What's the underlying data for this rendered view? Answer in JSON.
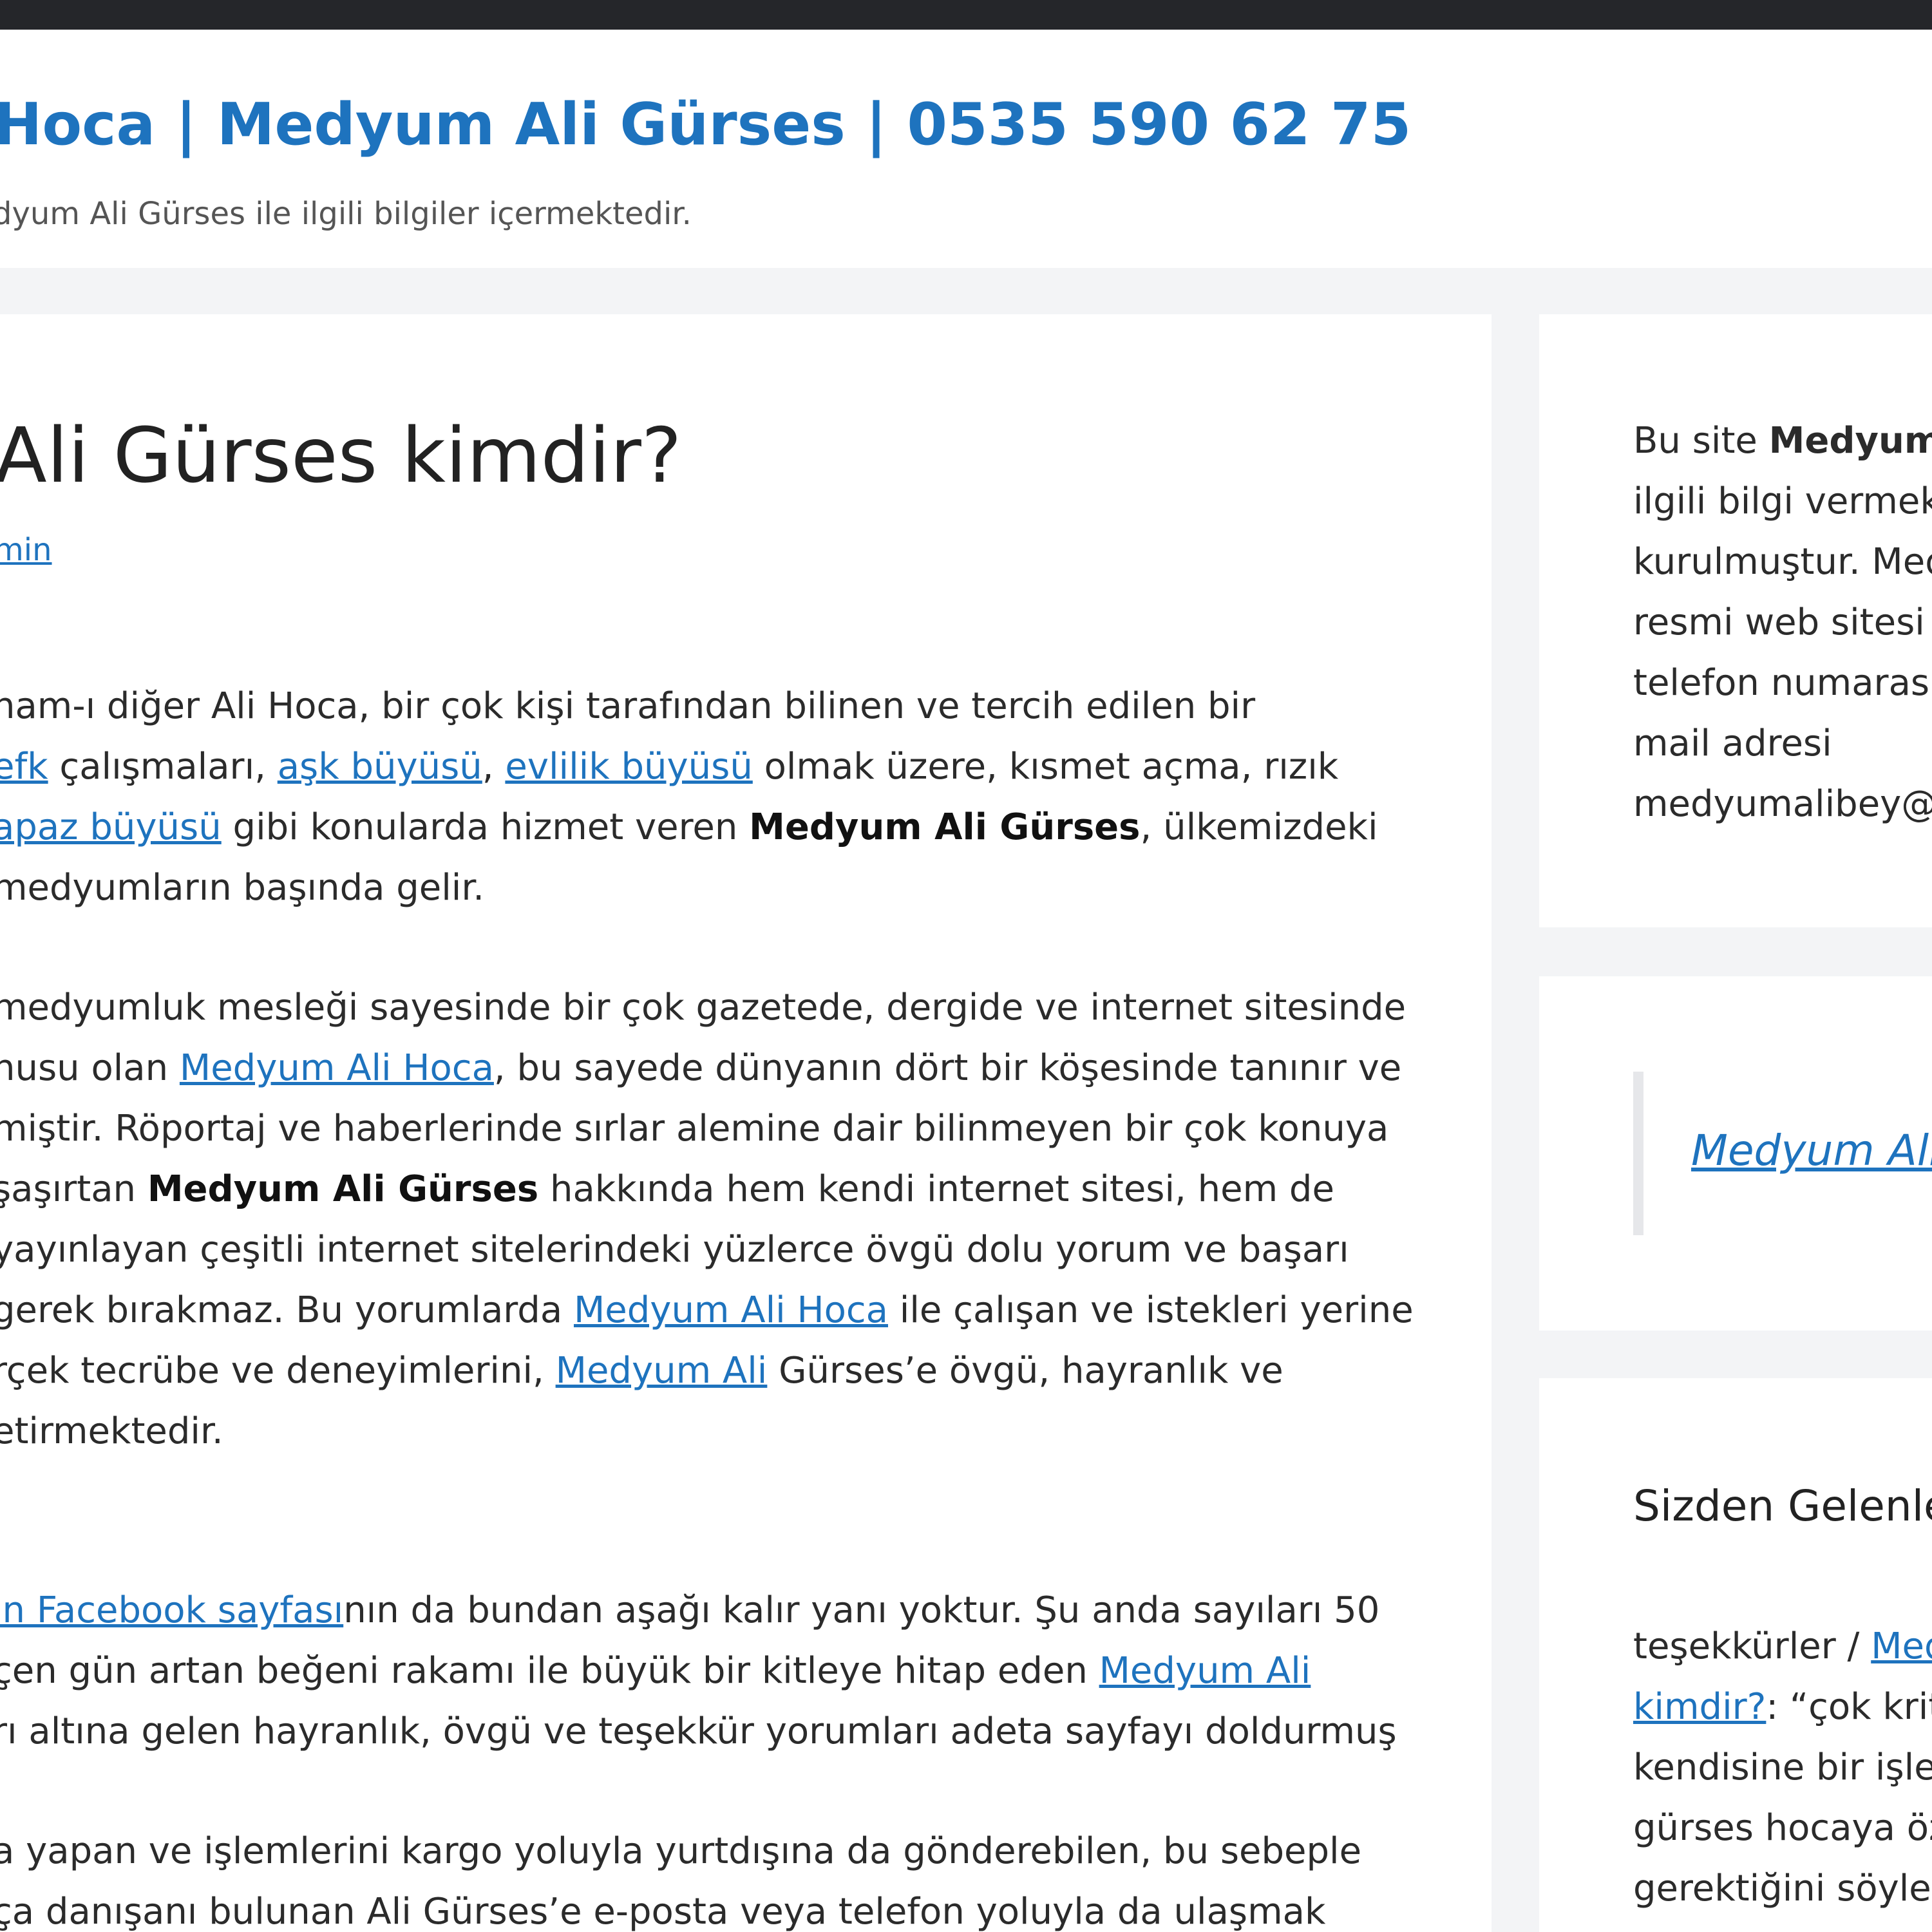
{
  "header": {
    "site_title": "Hoca | Medyum Ali Gürses | 0535 590 62 75",
    "tagline": "dyum Ali Gürses ile ilgili bilgiler içermektedir."
  },
  "post": {
    "title": "Ali Gürses kimdir?",
    "author_link": "min",
    "p1": {
      "l1": "nam-ı diğer Ali Hoca, bir çok kişi tarafından bilinen ve tercih edilen bir",
      "l2_link1": "efk",
      "l2_t1": " çalışmaları, ",
      "l2_link2": "aşk büyüsü",
      "l2_t2": ", ",
      "l2_link3": "evlilik büyüsü",
      "l2_t3": " olmak üzere, kısmet açma, rızık",
      "l3_link": "apaz büyüsü",
      "l3_t1": " gibi konularda hizmet veren ",
      "l3_bold": "Medyum Ali Gürses",
      "l3_t2": ", ülkemizdeki",
      "l4": "medyumların başında gelir."
    },
    "p2": {
      "l1": "medyumluk mesleği sayesinde bir çok gazetede, dergide ve internet sitesinde",
      "l2_t1": "nusu olan ",
      "l2_link": "Medyum Ali Hoca",
      "l2_t2": ", bu sayede dünyanın dört bir köşesinde tanınır ve",
      "l3": "miştir. Röportaj ve haberlerinde sırlar alemine dair bilinmeyen bir çok konuya",
      "l4_t1": "şaşırtan ",
      "l4_bold": "Medyum Ali Gürses",
      "l4_t2": " hakkında hem kendi internet sitesi, hem de",
      "l5": "yayınlayan çeşitli internet sitelerindeki yüzlerce övgü dolu yorum ve başarı",
      "l6_t1": "gerek bırakmaz. Bu yorumlarda ",
      "l6_link": "Medyum Ali Hoca",
      "l6_t2": " ile çalışan ve istekleri yerine",
      "l7_t1": "rçek tecrübe ve deneyimlerini, ",
      "l7_link": "Medyum Ali",
      "l7_t2": " Gürses’e övgü, hayranlık ve",
      "l8": "etirmektedir."
    },
    "p3": {
      "l1_link": "in Facebook sayfası",
      "l1_t1": "nın da bundan aşağı kalır yanı yoktur. Şu anda sayıları 50",
      "l2_t1": "çen gün artan beğeni rakamı ile büyük bir kitleye hitap eden ",
      "l2_link": "Medyum Ali",
      "l3": "rı altına gelen hayranlık, övgü ve teşekkür yorumları adeta sayfayı doldurmuş"
    },
    "p4": {
      "l1": "a yapan ve işlemlerini kargo yoluyla yurtdışına da gönderebilen, bu sebeple",
      "l2": "ça danışanı bulunan Ali Gürses’e e-posta veya telefon yoluyla da ulaşmak"
    }
  },
  "sidebar": {
    "about": {
      "l1_t1": "Bu site ",
      "l1_bold": "Medyum",
      "l2": "ilgili bilgi vermek",
      "l3": "kurulmuştur. Med",
      "l4": "resmi web sitesi n",
      "l5": "telefon numarası",
      "l6": "mail adresi",
      "l7": "medyumalibey@"
    },
    "quote_link": "Medyum Ali",
    "comments_title": "Sizden Gelenle",
    "comments": {
      "l1_t1": "teşekkürler / ",
      "l1_link": "Med",
      "l2_link": "kimdir?",
      "l2_t1": ": “çok krit",
      "l3": "kendisine bir işlem",
      "l4": "gürses hocaya öz",
      "l5": "gerektiğini söyled"
    }
  }
}
